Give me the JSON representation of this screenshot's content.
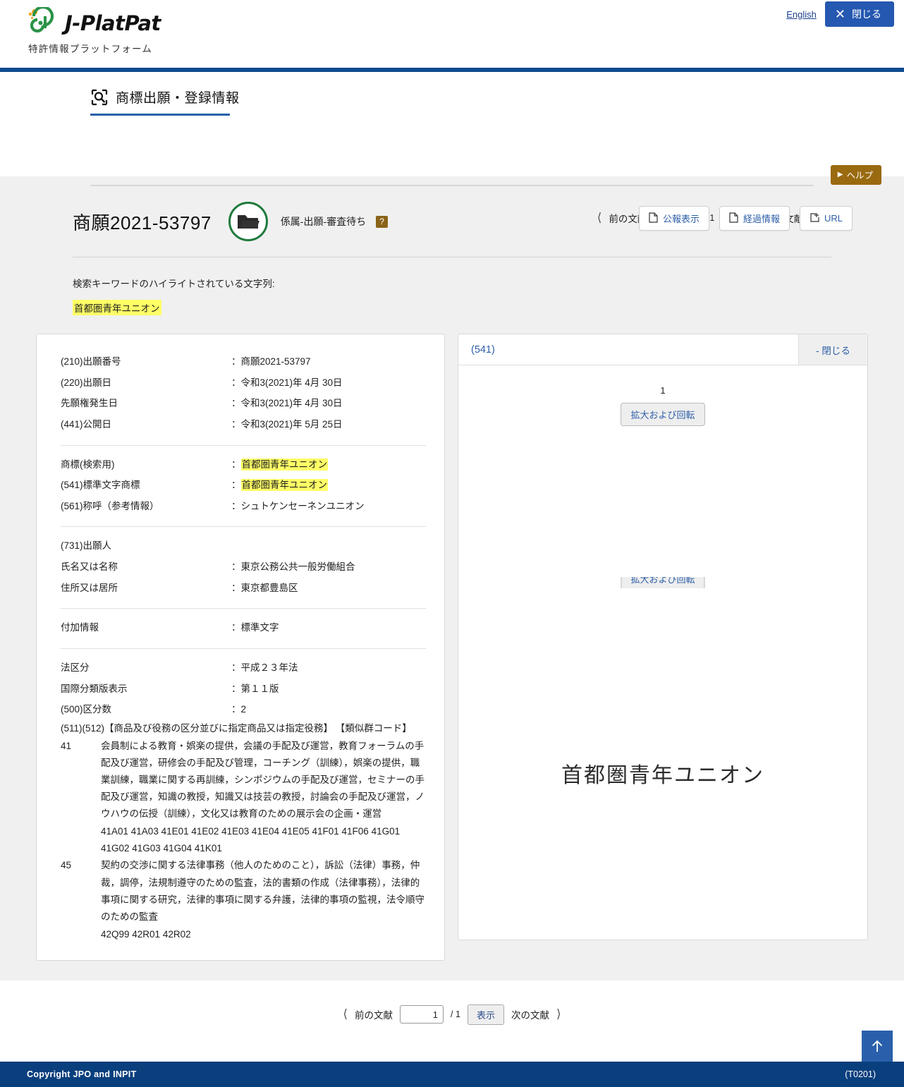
{
  "header": {
    "logo_text": "J-PlatPat",
    "logo_sub": "特許情報プラットフォーム",
    "english_link": "English",
    "close_label": "閉じる"
  },
  "page": {
    "title": "商標出願・登録情報",
    "help_label": "ヘルプ"
  },
  "pager": {
    "prev_label": "前の文献",
    "next_label": "次の文献",
    "current": "1",
    "total": "/ 1",
    "show_label": "表示"
  },
  "document": {
    "number": "商願2021-53797",
    "status": "係属-出願-審査待ち",
    "help_mark": "?",
    "actions": [
      {
        "label": "公報表示",
        "icon": "document-icon"
      },
      {
        "label": "経過情報",
        "icon": "document-icon"
      },
      {
        "label": "URL",
        "icon": "external-link-icon"
      }
    ]
  },
  "keyword": {
    "label": "検索キーワードのハイライトされている文字列:",
    "term": "首都圏青年ユニオン"
  },
  "details": {
    "group1": [
      {
        "key": "(210)出願番号",
        "value": "商願2021-53797",
        "highlight": false
      },
      {
        "key": "(220)出願日",
        "value": "令和3(2021)年 4月 30日",
        "highlight": false
      },
      {
        "key": "先願権発生日",
        "value": "令和3(2021)年 4月 30日",
        "highlight": false
      },
      {
        "key": "(441)公開日",
        "value": "令和3(2021)年 5月 25日",
        "highlight": false
      }
    ],
    "group2": [
      {
        "key": "商標(検索用)",
        "value": "首都圏青年ユニオン",
        "highlight": true
      },
      {
        "key": "(541)標準文字商標",
        "value": "首都圏青年ユニオン",
        "highlight": true
      },
      {
        "key": "(561)称呼（参考情報）",
        "value": "シュトケンセーネンユニオン",
        "highlight": false
      }
    ],
    "group3_title": "(731)出願人",
    "group3": [
      {
        "key": "氏名又は名称",
        "value": "東京公務公共一般労働組合",
        "highlight": false
      },
      {
        "key": "住所又は居所",
        "value": "東京都豊島区",
        "highlight": false
      }
    ],
    "group4": [
      {
        "key": "付加情報",
        "value": "標準文字",
        "highlight": false
      }
    ],
    "group5": [
      {
        "key": "法区分",
        "value": "平成２３年法",
        "highlight": false
      },
      {
        "key": "国際分類版表示",
        "value": "第１１版",
        "highlight": false
      },
      {
        "key": "(500)区分数",
        "value": "2",
        "highlight": false
      }
    ],
    "classes_header": "(511)(512)【商品及び役務の区分並びに指定商品又は指定役務】 【類似群コード】",
    "classes": [
      {
        "number": "41",
        "goods": "会員制による教育・娯楽の提供，会議の手配及び運営，教育フォーラムの手配及び運営，研修会の手配及び管理，コーチング（訓練），娯楽の提供，職業訓練，職業に関する再訓練，シンポジウムの手配及び運営，セミナーの手配及び運営，知識の教授，知識又は技芸の教授，討論会の手配及び運営，ノウハウの伝授（訓練），文化又は教育のための展示会の企画・運営",
        "codes": "41A01 41A03 41E01 41E02 41E03 41E04 41E05 41F01 41F06 41G01 41G02 41G03 41G04 41K01"
      },
      {
        "number": "45",
        "goods": "契約の交渉に関する法律事務（他人のためのこと），訴訟（法律）事務，仲裁，調停，法規制遵守のための監査，法的書類の作成（法律事務），法律的事項に関する研究，法律的事項に関する弁護，法律的事項の監視，法令順守のための監査",
        "codes": "42Q99 42R01 42R02"
      }
    ]
  },
  "image_panel": {
    "title": "(541)",
    "collapse_label": "- 閉じる",
    "index": "1",
    "zoom_label": "拡大および回転",
    "trademark_text": "首都圏青年ユニオン"
  },
  "footer": {
    "copyright": "Copyright JPO and INPIT",
    "code": "(T0201)"
  },
  "colors": {
    "brand_blue": "#0d4a8f",
    "button_blue": "#2558b0",
    "help_brown": "#9a6a10",
    "link_blue": "#2d5fa8",
    "highlight_yellow": "#ffff66",
    "footer_blue": "#0a3f7e",
    "logo_green": "#1f7a3d"
  }
}
